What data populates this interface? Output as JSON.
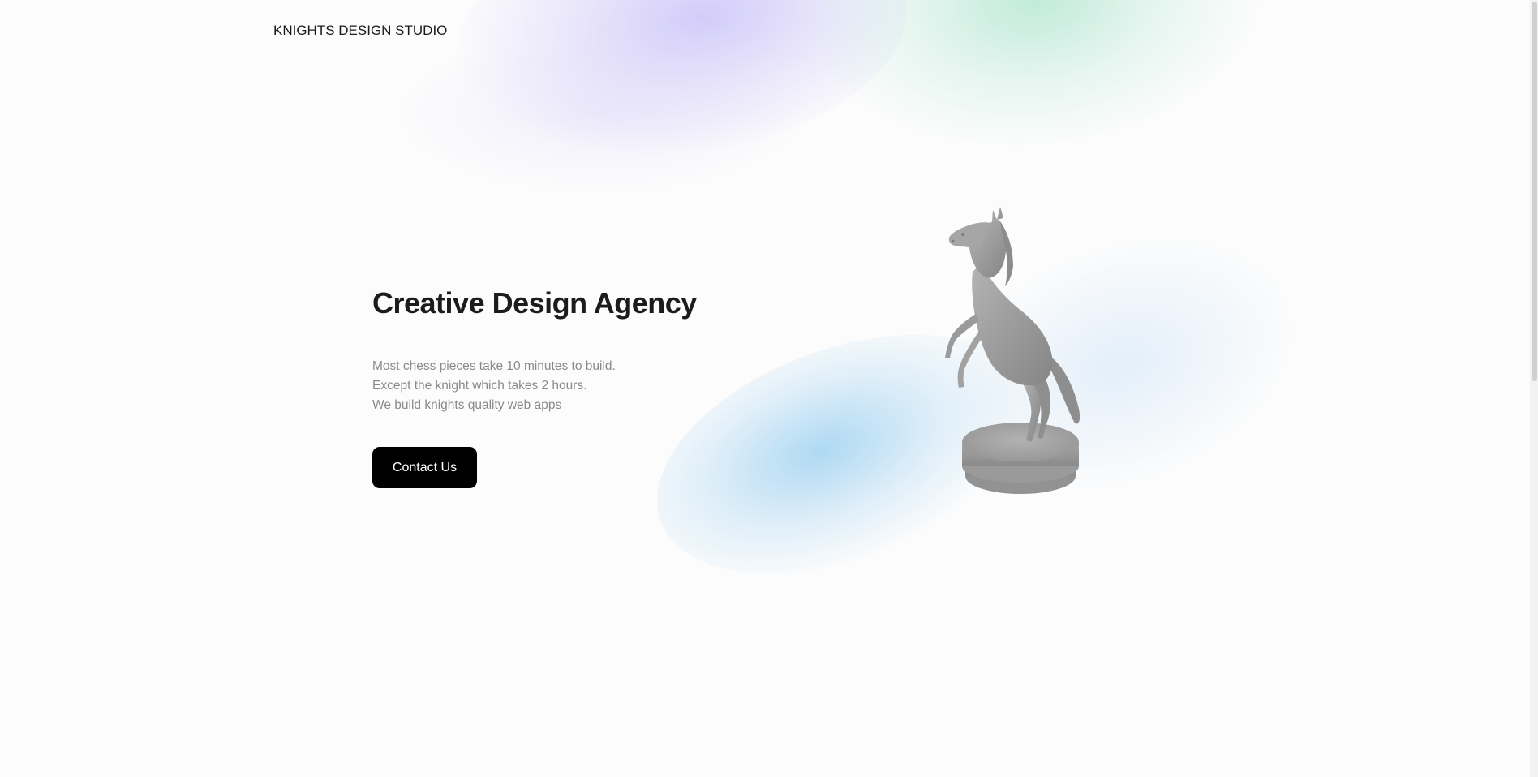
{
  "header": {
    "brand": "KNIGHTS DESIGN STUDIO"
  },
  "hero": {
    "title": "Creative Design Agency",
    "lines": [
      "Most chess pieces take 10 minutes to build.",
      "Except the knight which takes 2 hours.",
      "We build knights quality web apps"
    ],
    "cta_label": "Contact Us"
  },
  "illustration": {
    "icon": "chess-knight-horse-icon"
  },
  "colors": {
    "background": "#fcfcfc",
    "button": "#000000",
    "button_text": "#ffffff",
    "title": "#1c1c1c",
    "body_text": "#8a8a8a",
    "blob_purple": "#c4bcf8",
    "blob_mint": "#b2e6d2",
    "blob_blue": "#94cdf0"
  }
}
